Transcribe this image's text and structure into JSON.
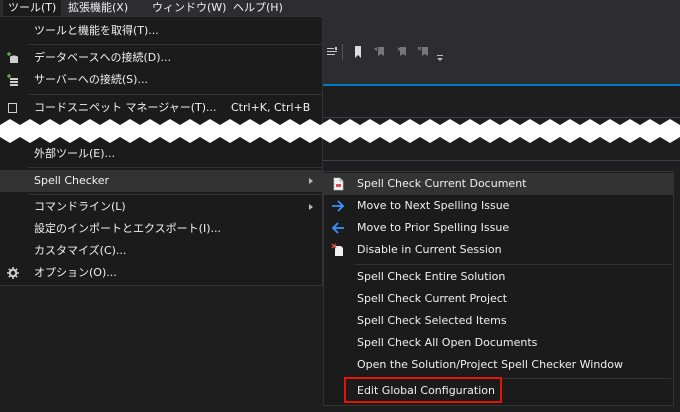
{
  "menubar": {
    "items": [
      "ツール(T)",
      "拡張機能(X)",
      "ウィンドウ(W)",
      "ヘルプ(H)"
    ]
  },
  "tools_menu": {
    "items": [
      {
        "label": "ツールと機能を取得(T)...",
        "icon": ""
      },
      {
        "label": "データベースへの接続(D)...",
        "icon": "database-connect-icon"
      },
      {
        "label": "サーバーへの接続(S)...",
        "icon": "server-connect-icon"
      },
      {
        "label": "コードスニペット マネージャー(T)...",
        "shortcut": "Ctrl+K, Ctrl+B",
        "icon": "snippet-icon"
      },
      {
        "label": "外部ツール(E)..."
      },
      {
        "label": "Spell Checker",
        "submenu": true
      },
      {
        "label": "コマンドライン(L)",
        "submenu": true
      },
      {
        "label": "設定のインポートとエクスポート(I)..."
      },
      {
        "label": "カスタマイズ(C)..."
      },
      {
        "label": "オプション(O)...",
        "icon": "gear-icon"
      }
    ]
  },
  "spell_submenu": {
    "items": [
      {
        "label": "Spell Check Current Document",
        "icon": "document-icon"
      },
      {
        "label": "Move to Next Spelling Issue",
        "icon": "arrow-right-icon"
      },
      {
        "label": "Move to Prior Spelling Issue",
        "icon": "arrow-left-icon"
      },
      {
        "label": "Disable in Current Session",
        "icon": "disable-session-icon"
      },
      {
        "label": "Spell Check Entire Solution"
      },
      {
        "label": "Spell Check Current Project"
      },
      {
        "label": "Spell Check Selected Items"
      },
      {
        "label": "Spell Check All Open Documents"
      },
      {
        "label": "Open the Solution/Project Spell Checker Window"
      },
      {
        "label": "Edit Global Configuration",
        "highlighted": true
      }
    ]
  },
  "colors": {
    "accent": "#007acc",
    "highlight": "#e51400",
    "menu_bg": "#1b1b1c",
    "hover_bg": "#333334"
  }
}
